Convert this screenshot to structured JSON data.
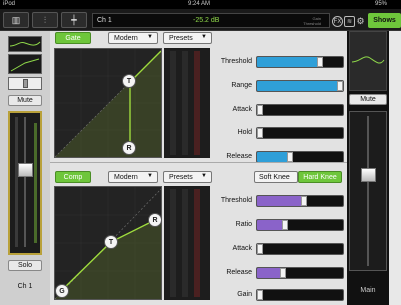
{
  "status": {
    "carrier": "iPod",
    "time": "9:24 AM",
    "battery": "95%"
  },
  "toolbar": {
    "channel_name": "Ch 1",
    "level": "-25.2 dB",
    "level_label_1": "Gain",
    "level_label_2": "Threshold",
    "fx_label": "FX",
    "shows_label": "Shows"
  },
  "left": {
    "mute_label": "Mute",
    "solo_label": "Solo",
    "channel_label": "Ch 1"
  },
  "gate": {
    "enable_label": "Gate",
    "mode_value": "Modern",
    "presets_label": "Presets",
    "params": [
      {
        "name": "Threshold",
        "value": 0.73,
        "color": "#2f9fd8"
      },
      {
        "name": "Range",
        "value": 1.0,
        "color": "#2f9fd8"
      },
      {
        "name": "Attack",
        "value": 0.04,
        "color": "#2f9fd8"
      },
      {
        "name": "Hold",
        "value": 0.02,
        "color": "#2f9fd8"
      },
      {
        "name": "Release",
        "value": 0.38,
        "color": "#2f9fd8"
      }
    ],
    "node_t": "T",
    "node_r": "R"
  },
  "comp": {
    "enable_label": "Comp",
    "mode_value": "Modern",
    "presets_label": "Presets",
    "soft_knee_label": "Soft Knee",
    "hard_knee_label": "Hard Knee",
    "params": [
      {
        "name": "Threshold",
        "value": 0.55,
        "color": "#8a63c9"
      },
      {
        "name": "Ratio",
        "value": 0.32,
        "color": "#8a63c9"
      },
      {
        "name": "Attack",
        "value": 0.03,
        "color": "#8a63c9"
      },
      {
        "name": "Release",
        "value": 0.3,
        "color": "#8a63c9"
      },
      {
        "name": "Gain",
        "value": 0.04,
        "color": "#8a63c9"
      }
    ],
    "node_g": "G",
    "node_t": "T",
    "node_r": "R"
  },
  "right": {
    "mute_label": "Mute",
    "channel_label": "Main"
  }
}
